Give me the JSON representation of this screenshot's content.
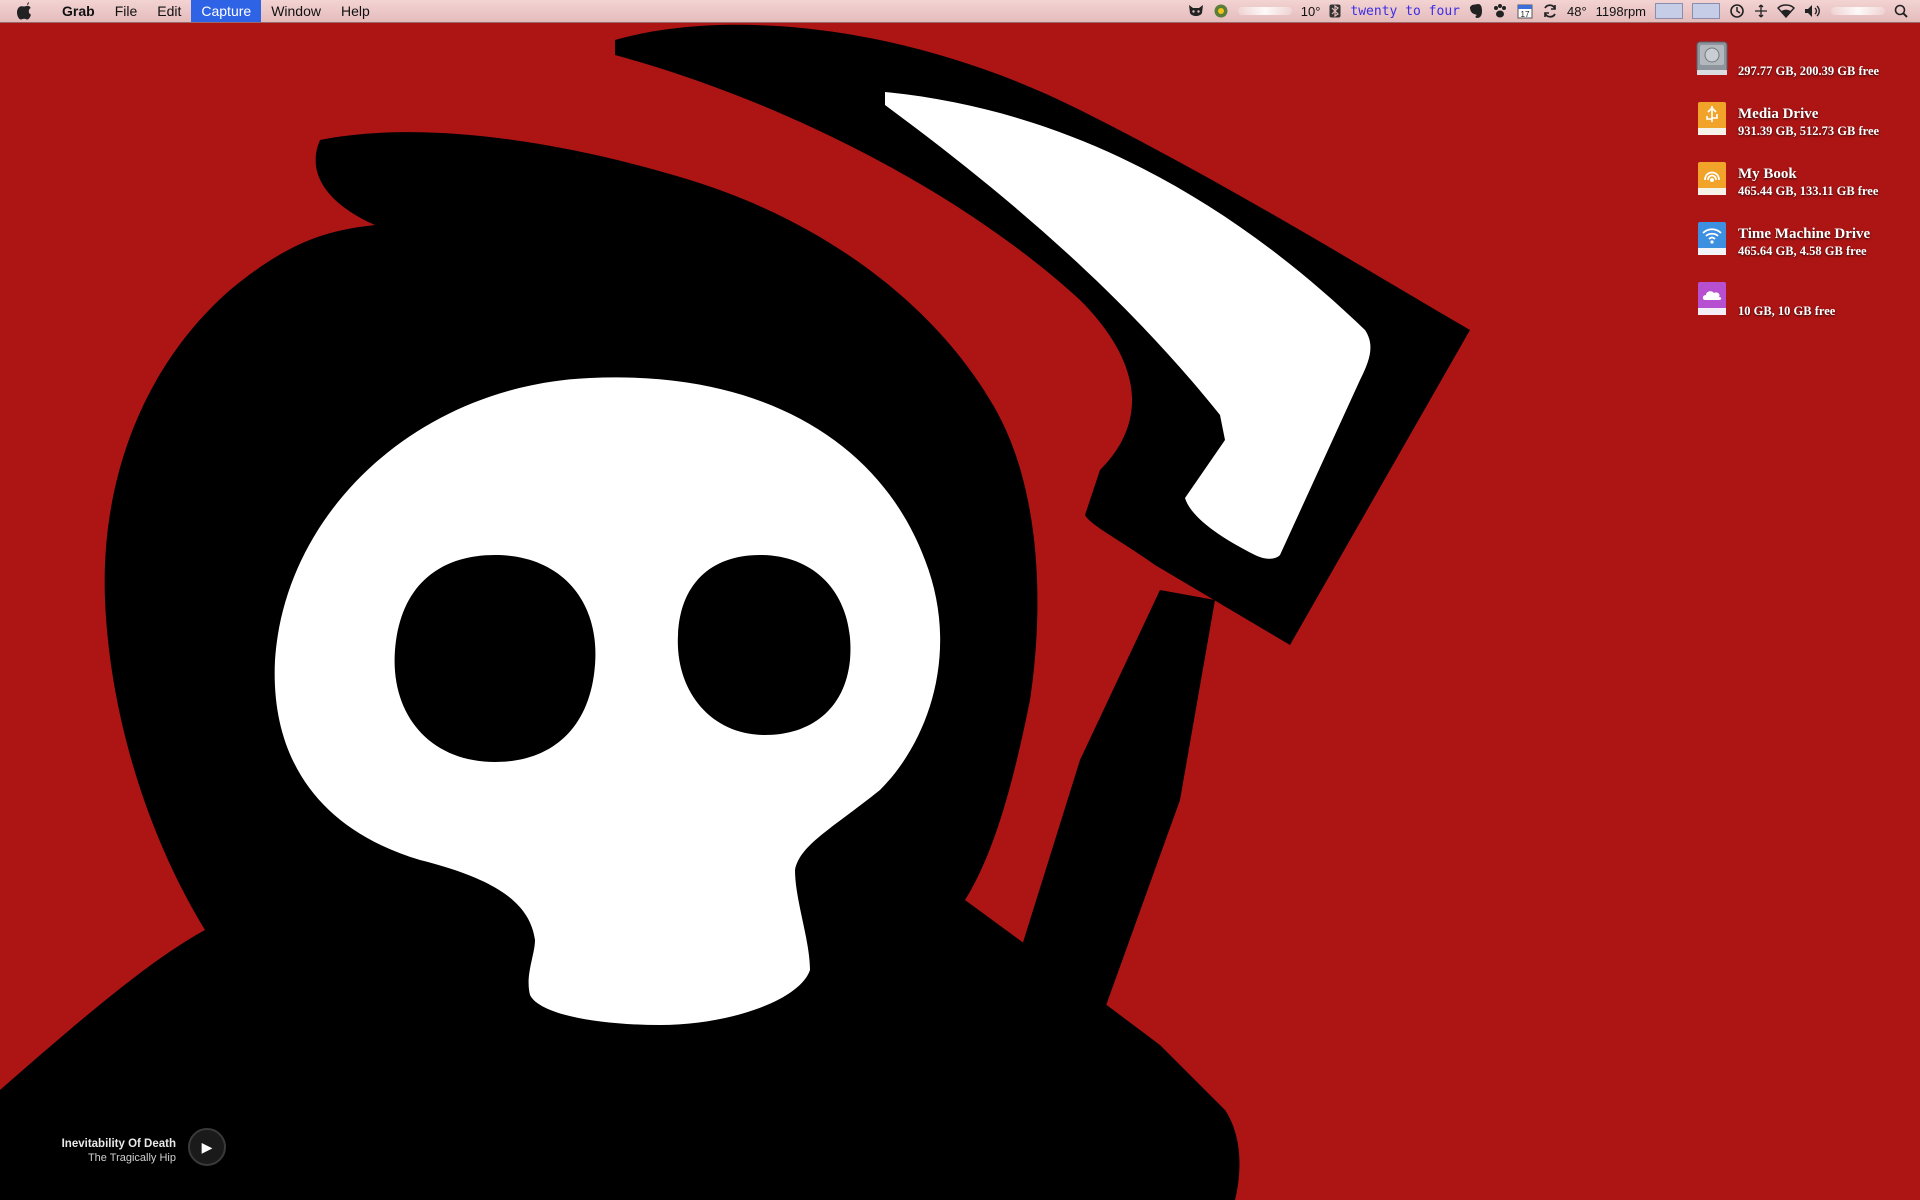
{
  "menubar": {
    "app_name": "Grab",
    "menus": [
      "File",
      "Edit",
      "Capture",
      "Window",
      "Help"
    ],
    "active_menu": "Capture",
    "status": {
      "weather_temp": "10°",
      "clock_text": "twenty to four",
      "calendar_day": "17",
      "cpu_temp": "48°",
      "fan_speed": "1198rpm"
    },
    "icons": [
      "apple-icon",
      "cat-icon",
      "weather-icon",
      "bluetooth-icon",
      "evernote-icon",
      "paw-icon",
      "calendar-icon",
      "sync-icon",
      "memory-meter",
      "cpu-meter",
      "time-machine-icon",
      "arrows-icon",
      "wifi-icon",
      "volume-icon",
      "spotlight-icon"
    ]
  },
  "drives": [
    {
      "name": "",
      "info": "297.77 GB, 200.39 GB free",
      "icon": "internal-drive-icon",
      "color": "#9aa0a8"
    },
    {
      "name": "Media Drive",
      "info": "931.39 GB, 512.73 GB free",
      "icon": "usb-drive-icon",
      "color": "#f2a42a"
    },
    {
      "name": "My Book",
      "info": "465.44 GB, 133.11 GB free",
      "icon": "firewire-drive-icon",
      "color": "#f2a42a"
    },
    {
      "name": "Time Machine Drive",
      "info": "465.64 GB, 4.58 GB free",
      "icon": "wifi-drive-icon",
      "color": "#3d8fe0"
    },
    {
      "name": "",
      "info": "10 GB, 10 GB free",
      "icon": "cloud-drive-icon",
      "color": "#b64fd0"
    }
  ],
  "now_playing": {
    "title": "Inevitability Of Death",
    "artist": "The Tragically Hip"
  },
  "colors": {
    "wallpaper": "#ad1515",
    "menu_highlight": "#2f63e6"
  }
}
